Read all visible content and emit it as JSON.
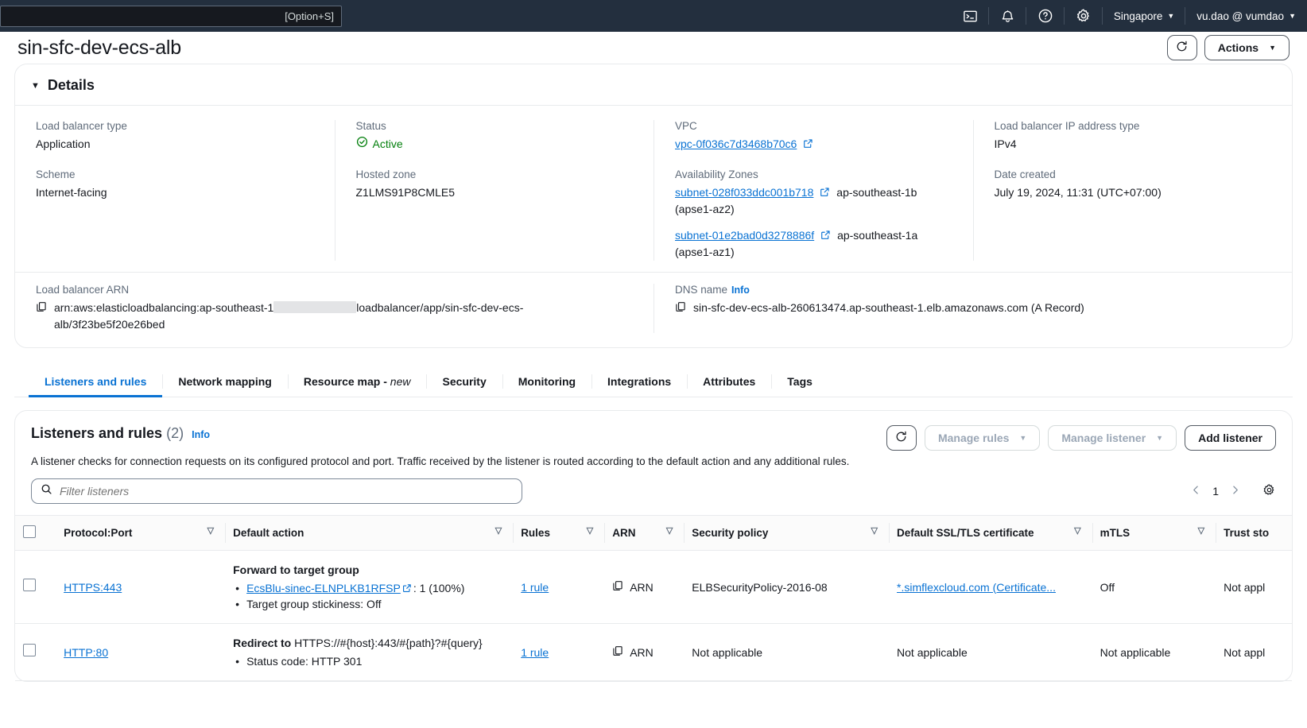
{
  "topnav": {
    "search_shortcut": "[Option+S]",
    "cloudshell_icon": "terminal-icon",
    "notifications_icon": "bell-icon",
    "help_icon": "question-circle-icon",
    "settings_icon": "gear-icon",
    "region": "Singapore",
    "account": "vu.dao @ vumdao"
  },
  "header": {
    "title": "sin-sfc-dev-ecs-alb",
    "refresh_icon": "refresh-icon",
    "actions_label": "Actions"
  },
  "details": {
    "section_title": "Details",
    "fields": {
      "lb_type_label": "Load balancer type",
      "lb_type_value": "Application",
      "scheme_label": "Scheme",
      "scheme_value": "Internet-facing",
      "status_label": "Status",
      "status_value": "Active",
      "hosted_zone_label": "Hosted zone",
      "hosted_zone_value": "Z1LMS91P8CMLE5",
      "vpc_label": "VPC",
      "vpc_value": "vpc-0f036c7d3468b70c6",
      "az_label": "Availability Zones",
      "az": [
        {
          "subnet": "subnet-028f033ddc001b718",
          "zone": "ap-southeast-1b",
          "zone_id": "(apse1-az2)"
        },
        {
          "subnet": "subnet-01e2bad0d3278886f",
          "zone": "ap-southeast-1a",
          "zone_id": "(apse1-az1)"
        }
      ],
      "ip_type_label": "Load balancer IP address type",
      "ip_type_value": "IPv4",
      "date_created_label": "Date created",
      "date_created_value": "July 19, 2024, 11:31 (UTC+07:00)",
      "arn_label": "Load balancer ARN",
      "arn_prefix": "arn:aws:elasticloadbalancing:ap-southeast-1",
      "arn_suffix": "loadbalancer/app/sin-sfc-dev-ecs-alb/3f23be5f20e26bed",
      "dns_label": "DNS name",
      "dns_info": "Info",
      "dns_value": "sin-sfc-dev-ecs-alb-260613474.ap-southeast-1.elb.amazonaws.com (A Record)"
    }
  },
  "tabs": [
    {
      "label": "Listeners and rules",
      "active": true
    },
    {
      "label": "Network mapping",
      "active": false
    },
    {
      "label": "Resource map -",
      "suffix": "new",
      "active": false
    },
    {
      "label": "Security",
      "active": false
    },
    {
      "label": "Monitoring",
      "active": false
    },
    {
      "label": "Integrations",
      "active": false
    },
    {
      "label": "Attributes",
      "active": false
    },
    {
      "label": "Tags",
      "active": false
    }
  ],
  "listeners": {
    "title": "Listeners and rules",
    "count": "(2)",
    "info": "Info",
    "description": "A listener checks for connection requests on its configured protocol and port. Traffic received by the listener is routed according to the default action and any additional rules.",
    "refresh_icon": "refresh-icon",
    "manage_rules": "Manage rules",
    "manage_listener": "Manage listener",
    "add_listener": "Add listener",
    "filter_placeholder": "Filter listeners",
    "page_number": "1",
    "prev_icon": "chevron-left-icon",
    "next_icon": "chevron-right-icon",
    "preferences_icon": "gear-icon",
    "columns": [
      "Protocol:Port",
      "Default action",
      "Rules",
      "ARN",
      "Security policy",
      "Default SSL/TLS certificate",
      "mTLS",
      "Trust sto"
    ],
    "rows": [
      {
        "protocol_port": "HTTPS:443",
        "action_title": "Forward to target group",
        "action_items": [
          {
            "link": "EcsBlu-sinec-ELNPLKB1RFSP",
            "external": true,
            "tail": ": 1 (100%)"
          },
          {
            "link": "",
            "external": false,
            "tail": "Target group stickiness: Off"
          }
        ],
        "rules": "1 rule",
        "arn": "ARN",
        "security_policy": "ELBSecurityPolicy-2016-08",
        "certificate": "*.simflexcloud.com (Certificate...",
        "certificate_is_link": true,
        "mtls": "Off",
        "trust_store": "Not appl"
      },
      {
        "protocol_port": "HTTP:80",
        "action_title": "Redirect to",
        "action_inline": "HTTPS://#{host}:443/#{path}?#{query}",
        "action_items": [
          {
            "link": "",
            "external": false,
            "tail": "Status code: HTTP  301"
          }
        ],
        "rules": "1 rule",
        "arn": "ARN",
        "security_policy": "Not applicable",
        "certificate": "Not applicable",
        "certificate_is_link": false,
        "mtls": "Not applicable",
        "trust_store": "Not appl"
      }
    ]
  },
  "colors": {
    "nav_bg": "#232f3e",
    "link": "#0972d3",
    "success": "#037f0c",
    "border": "#e9ebed"
  }
}
